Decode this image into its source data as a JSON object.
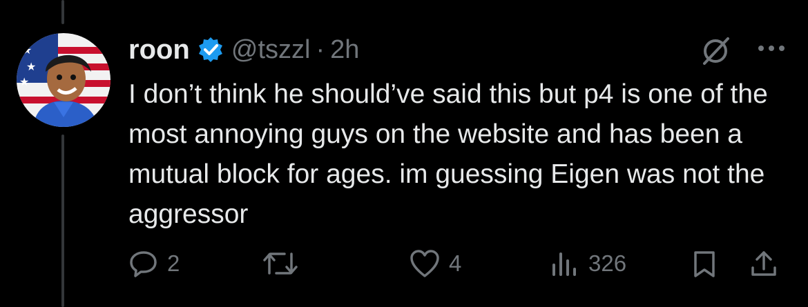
{
  "tweet": {
    "author_name": "roon",
    "handle": "@tszzl",
    "separator": "·",
    "time": "2h",
    "text": "I don’t think he should’ve said this but p4 is one of the most annoying guys on the website and has been a mutual block for ages. im guessing Eigen was not the aggressor"
  },
  "actions": {
    "replies": "2",
    "likes": "4",
    "views": "326"
  },
  "colors": {
    "background": "#000000",
    "text": "#e7e9ea",
    "muted": "#71767b",
    "verified": "#1d9bf0"
  },
  "icons": [
    "verified-badge-icon",
    "grok-icon",
    "more-icon",
    "reply-icon",
    "retweet-icon",
    "like-icon",
    "views-icon",
    "bookmark-icon",
    "share-icon"
  ]
}
